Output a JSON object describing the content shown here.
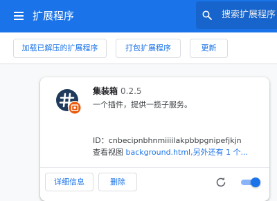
{
  "header": {
    "title": "扩展程序",
    "search_placeholder": "搜索扩展程序"
  },
  "toolbar": {
    "load_unpacked_label": "加载已解压的扩展程序",
    "pack_label": "打包扩展程序",
    "update_label": "更新"
  },
  "extension": {
    "name": "集装箱",
    "version": "0.2.5",
    "description": "一个插件，提供一揽子服务。",
    "id_text": "ID：cnbecipnbhnmiiiilakpbbpgnipefjkjn",
    "views_prefix": "查看视图",
    "views_link": "background.html,另外还有 1 个...",
    "details_label": "详细信息",
    "remove_label": "删除",
    "enabled": true
  },
  "colors": {
    "header_bg": "#1a73e8",
    "accent": "#1a73e8",
    "page_bg": "#f8f9fa",
    "icon_badge": "#e8590c"
  },
  "icons": [
    "menu-icon",
    "search-icon",
    "extension-icon",
    "reload-icon"
  ]
}
